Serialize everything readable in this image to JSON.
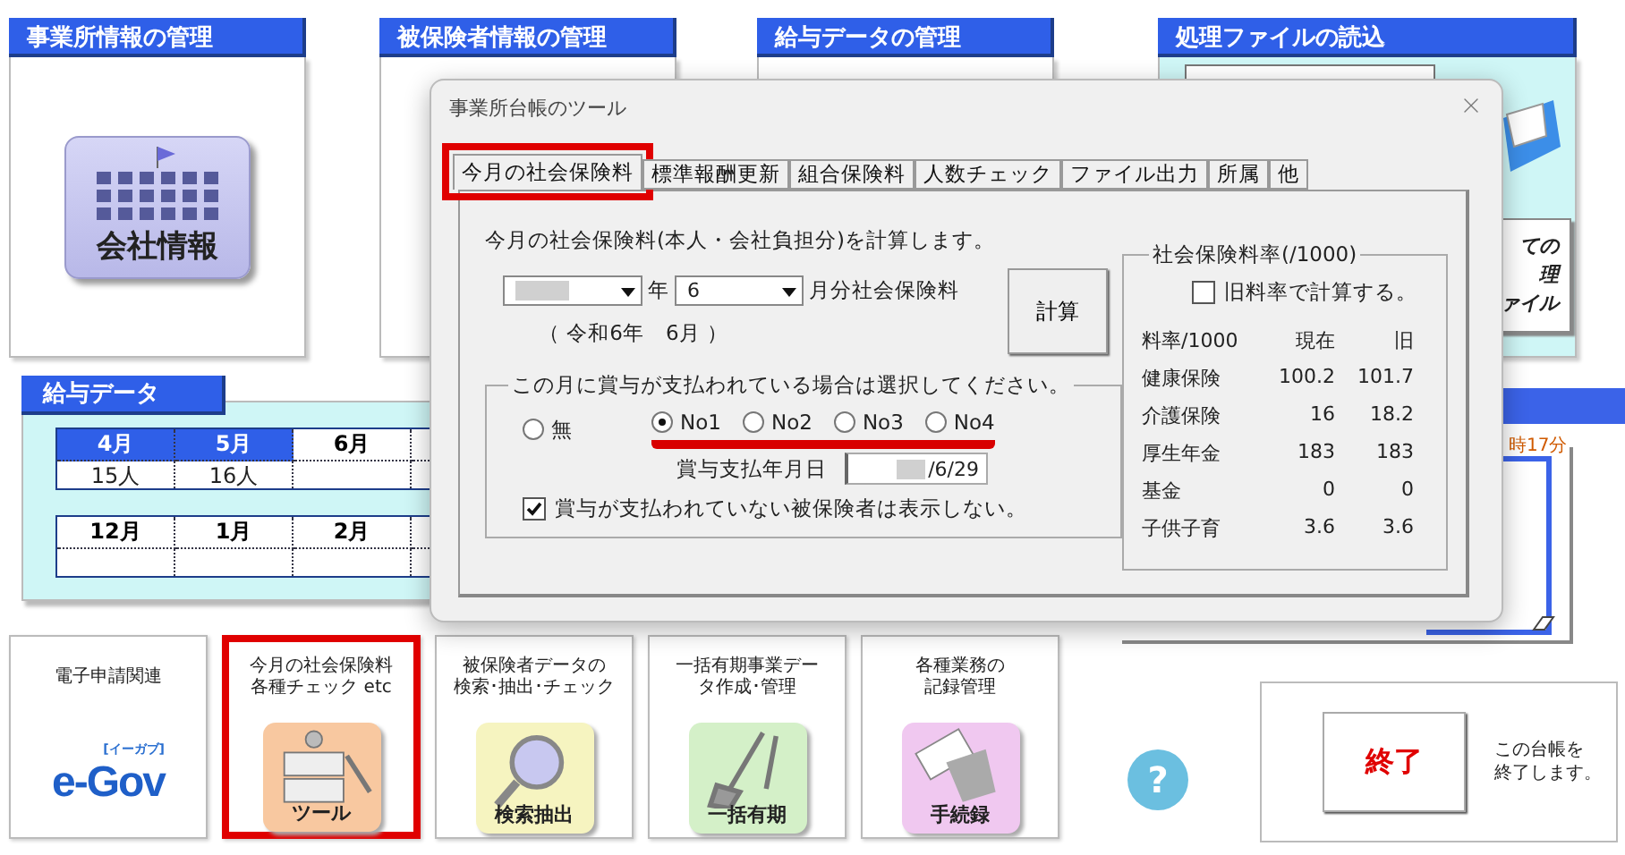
{
  "top_panels": [
    {
      "title": "事業所情報の管理",
      "kind": "company",
      "icon_label": "会社情報"
    },
    {
      "title": "被保険者情報の管理",
      "kind": "plain"
    },
    {
      "title": "給与データの管理",
      "kind": "plain"
    }
  ],
  "file_panel": {
    "title": "処理ファイルの読込",
    "button_lines": [
      "ての",
      "理",
      "ァイル"
    ]
  },
  "salary": {
    "title": "給与データ",
    "rows": [
      {
        "months": [
          {
            "label": "4月",
            "filled": true
          },
          {
            "label": "5月",
            "filled": true
          },
          {
            "label": "6月",
            "filled": false
          }
        ],
        "values": [
          "15人",
          "16人"
        ]
      },
      {
        "months": [
          {
            "label": "12月",
            "filled": false
          },
          {
            "label": "1月",
            "filled": false
          },
          {
            "label": "2月",
            "filled": false
          }
        ],
        "values": []
      }
    ]
  },
  "side_panel": {
    "time_text": "時17分"
  },
  "tiles": [
    {
      "kind": "egov",
      "caption_lines": [
        "電子申請関連"
      ],
      "logo_tag": "[イーガブ]",
      "logo": "e-Gov",
      "highlighted": false
    },
    {
      "kind": "tool",
      "caption_lines": [
        "今月の社会保険料",
        "各種チェック etc"
      ],
      "icon_label": "ツール",
      "highlighted": true
    },
    {
      "kind": "search",
      "caption_lines": [
        "被保険者データの",
        "検索･抽出･チェック"
      ],
      "icon_label": "検索抽出",
      "highlighted": false
    },
    {
      "kind": "shovel",
      "caption_lines": [
        "一括有期事業デー",
        "タ作成･管理"
      ],
      "icon_label": "一括有期",
      "highlighted": false
    },
    {
      "kind": "record",
      "caption_lines": [
        "各種業務の",
        "記録管理"
      ],
      "icon_label": "手続録",
      "highlighted": false
    }
  ],
  "help": {
    "label": "?"
  },
  "exit": {
    "button": "終了",
    "note_lines": [
      "この台帳を",
      "終了します。"
    ]
  },
  "dialog": {
    "title": "事業所台帳のツール",
    "tabs": [
      {
        "label": "今月の社会保険料",
        "selected": true,
        "highlighted": true
      },
      {
        "label": "標準報酬更新",
        "selected": false,
        "highlighted": false
      },
      {
        "label": "組合保険料",
        "selected": false,
        "highlighted": false
      },
      {
        "label": "人数チェック",
        "selected": false,
        "highlighted": false
      },
      {
        "label": "ファイル出力",
        "selected": false,
        "highlighted": false
      },
      {
        "label": "所属",
        "selected": false,
        "highlighted": false
      },
      {
        "label": "他",
        "selected": false,
        "highlighted": false
      }
    ],
    "description": "今月の社会保険料(本人・会社負担分)を計算します。",
    "year_redacted": true,
    "year_label": "年",
    "month_value": "6",
    "month_suffix": "月分社会保険料",
    "era_text": "（ 令和6年　6月 ）",
    "calc_button": "計算",
    "bonus": {
      "legend": "この月に賞与が支払われている場合は選択してください。",
      "options": [
        {
          "label": "無",
          "selected": false,
          "marked": false
        },
        {
          "label": "No1",
          "selected": true,
          "marked": true
        },
        {
          "label": "No2",
          "selected": false,
          "marked": true
        },
        {
          "label": "No3",
          "selected": false,
          "marked": true
        },
        {
          "label": "No4",
          "selected": false,
          "marked": true
        }
      ],
      "date_label": "賞与支払年月日",
      "date_value": "/6/29",
      "date_redacted": true,
      "hide_unpaid": {
        "label": "賞与が支払われていない被保険者は表示しない。",
        "checked": true
      }
    },
    "rates": {
      "legend": "社会保険料率(/1000)",
      "use_old": {
        "label": "旧料率で計算する。",
        "checked": false
      },
      "columns": [
        "料率/1000",
        "現在",
        "旧"
      ],
      "rows": [
        [
          "健康保険",
          "100.2",
          "101.7"
        ],
        [
          "介護保険",
          "16",
          "18.2"
        ],
        [
          "厚生年金",
          "183",
          "183"
        ],
        [
          "基金",
          "0",
          "0"
        ],
        [
          "子供子育",
          "3.6",
          "3.6"
        ]
      ]
    }
  }
}
